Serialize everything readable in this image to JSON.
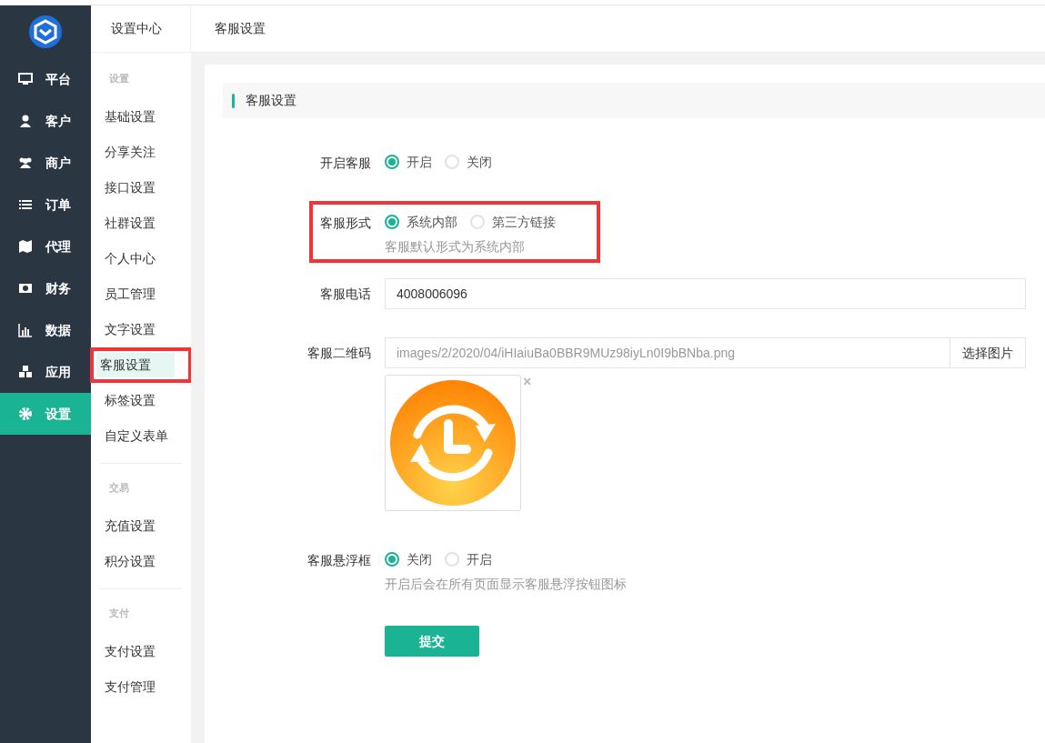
{
  "sidebar": {
    "items": [
      {
        "label": "平台",
        "selected": false
      },
      {
        "label": "客户",
        "selected": false
      },
      {
        "label": "商户",
        "selected": false
      },
      {
        "label": "订单",
        "selected": false
      },
      {
        "label": "代理",
        "selected": false
      },
      {
        "label": "财务",
        "selected": false
      },
      {
        "label": "数据",
        "selected": false
      },
      {
        "label": "应用",
        "selected": false
      },
      {
        "label": "设置",
        "selected": true
      }
    ]
  },
  "subnav": {
    "title": "设置中心",
    "groups": [
      {
        "label": "设置",
        "items": [
          {
            "label": "基础设置",
            "selected": false,
            "highlighted": false
          },
          {
            "label": "分享关注",
            "selected": false,
            "highlighted": false
          },
          {
            "label": "接口设置",
            "selected": false,
            "highlighted": false
          },
          {
            "label": "社群设置",
            "selected": false,
            "highlighted": false
          },
          {
            "label": "个人中心",
            "selected": false,
            "highlighted": false
          },
          {
            "label": "员工管理",
            "selected": false,
            "highlighted": false
          },
          {
            "label": "文字设置",
            "selected": false,
            "highlighted": false
          },
          {
            "label": "客服设置",
            "selected": true,
            "highlighted": true
          },
          {
            "label": "标签设置",
            "selected": false,
            "highlighted": false
          },
          {
            "label": "自定义表单",
            "selected": false,
            "highlighted": false
          }
        ]
      },
      {
        "label": "交易",
        "items": [
          {
            "label": "充值设置",
            "selected": false,
            "highlighted": false
          },
          {
            "label": "积分设置",
            "selected": false,
            "highlighted": false
          }
        ]
      },
      {
        "label": "支付",
        "items": [
          {
            "label": "支付设置",
            "selected": false,
            "highlighted": false
          },
          {
            "label": "支付管理",
            "selected": false,
            "highlighted": false
          }
        ]
      }
    ]
  },
  "breadcrumb": "客服设置",
  "section_title": "客服设置",
  "form": [
    {
      "kind": "radio",
      "label": "开启客服",
      "highlighted": false,
      "options": [
        {
          "label": "开启",
          "selected": true
        },
        {
          "label": "关闭",
          "selected": false
        }
      ]
    },
    {
      "kind": "radio",
      "label": "客服形式",
      "highlighted": true,
      "options": [
        {
          "label": "系统内部",
          "selected": true
        },
        {
          "label": "第三方链接",
          "selected": false
        }
      ],
      "hint": "客服默认形式为系统内部"
    },
    {
      "kind": "text",
      "label": "客服电话",
      "highlighted": false,
      "value": "4008006096"
    },
    {
      "label": "客服二维码",
      "highlighted": false,
      "value": "images/2/2020/04/iHIaiuBa0BBR9MUz98iyLn0I9bBNba.png",
      "button": "选择图片",
      "remove": "×"
    },
    {
      "kind": "radio",
      "label": "客服悬浮框",
      "highlighted": false,
      "options": [
        {
          "label": "关闭",
          "selected": true
        },
        {
          "label": "开启",
          "selected": false
        }
      ],
      "hint": "开启后会在所有页面显示客服悬浮按钮图标"
    }
  ],
  "submit": "提交"
}
